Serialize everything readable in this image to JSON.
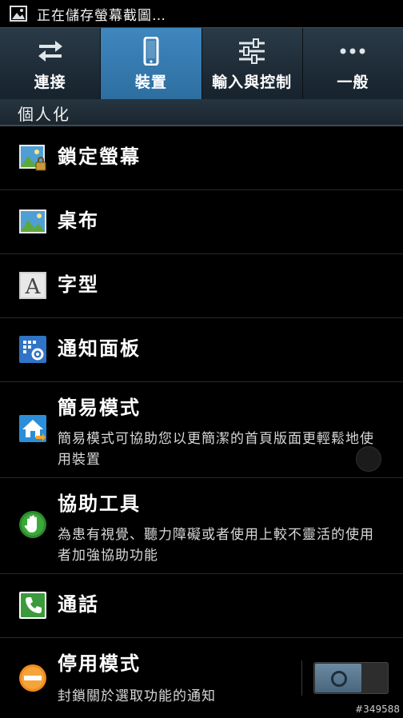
{
  "status_bar": {
    "notification_text": "正在儲存螢幕截圖…"
  },
  "tabs": [
    {
      "label": "連接",
      "icon": "swap-arrows-icon",
      "active": false
    },
    {
      "label": "裝置",
      "icon": "phone-device-icon",
      "active": true
    },
    {
      "label": "輸入與控制",
      "icon": "sliders-icon",
      "active": false
    },
    {
      "label": "一般",
      "icon": "more-dots-icon",
      "active": false
    }
  ],
  "section": {
    "header": "個人化"
  },
  "items": [
    {
      "title": "鎖定螢幕",
      "subtitle": "",
      "icon": "lock-screen-icon"
    },
    {
      "title": "桌布",
      "subtitle": "",
      "icon": "wallpaper-icon"
    },
    {
      "title": "字型",
      "subtitle": "",
      "icon": "font-icon"
    },
    {
      "title": "通知面板",
      "subtitle": "",
      "icon": "notification-panel-icon"
    },
    {
      "title": "簡易模式",
      "subtitle": "簡易模式可協助您以更簡潔的首頁版面更輕鬆地使用裝置",
      "icon": "easy-mode-icon"
    },
    {
      "title": "協助工具",
      "subtitle": "為患有視覺、聽力障礙或者使用上較不靈活的使用者加強協助功能",
      "icon": "accessibility-icon"
    },
    {
      "title": "通話",
      "subtitle": "",
      "icon": "call-icon"
    },
    {
      "title": "停用模式",
      "subtitle": "封鎖關於選取功能的通知",
      "icon": "blocking-mode-icon",
      "toggle": "on"
    }
  ],
  "watermark": "#349588",
  "colors": {
    "active_tab": "#3a80b6",
    "tab_bar": "#1f2e39",
    "background": "#000000"
  }
}
